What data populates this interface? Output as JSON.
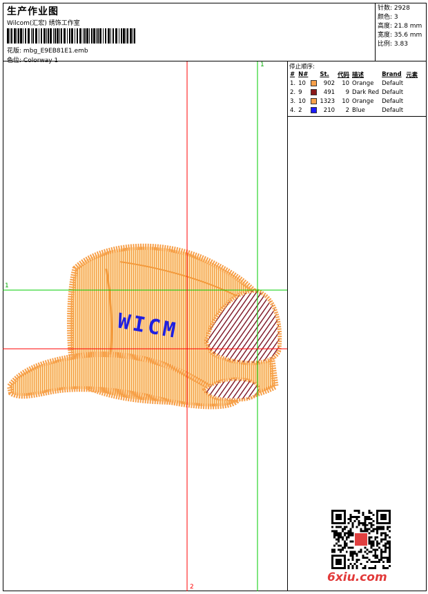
{
  "header": {
    "title": "生产作业图",
    "company": "Wilcom(汇宏) 绣饰工作室",
    "pattern_label": "花版:",
    "pattern_value": "mbg_E9EB81E1.emb",
    "color_label": "色位:",
    "color_value": "Colorway 1"
  },
  "stats": {
    "stitches": "针数: 2928",
    "colors": "颜色: 3",
    "height": "高度: 21.8 mm",
    "width": "宽度: 35.6 mm",
    "scale": "比例: 3.83"
  },
  "stop_sequence": {
    "title": "停止顺序:",
    "columns": [
      "#",
      "N#",
      "St.",
      "代码",
      "描述",
      "Brand",
      "元素"
    ],
    "rows": [
      {
        "idx": "1.",
        "n": "10",
        "st": "902",
        "code": "10",
        "desc": "Orange",
        "brand": "Default",
        "color": "#f7a04a"
      },
      {
        "idx": "2.",
        "n": "9",
        "st": "491",
        "code": "9",
        "desc": "Dark Red",
        "brand": "Default",
        "color": "#8b1a1a"
      },
      {
        "idx": "3.",
        "n": "10",
        "st": "1323",
        "code": "10",
        "desc": "Orange",
        "brand": "Default",
        "color": "#f7a04a"
      },
      {
        "idx": "4.",
        "n": "2",
        "st": "210",
        "code": "2",
        "desc": "Blue",
        "brand": "Default",
        "color": "#1a1aff"
      }
    ]
  },
  "canvas": {
    "axis_labels": {
      "top": "1",
      "left": "1",
      "bottom": "2"
    },
    "embroidery_text": "WICM",
    "colors": {
      "orange": "#f7a04a",
      "dark_red": "#7a1020",
      "blue": "#2020e0",
      "green_guide": "#00cc00",
      "red_guide": "#ff0000"
    }
  },
  "watermark": {
    "brand": "6xiu.com"
  }
}
